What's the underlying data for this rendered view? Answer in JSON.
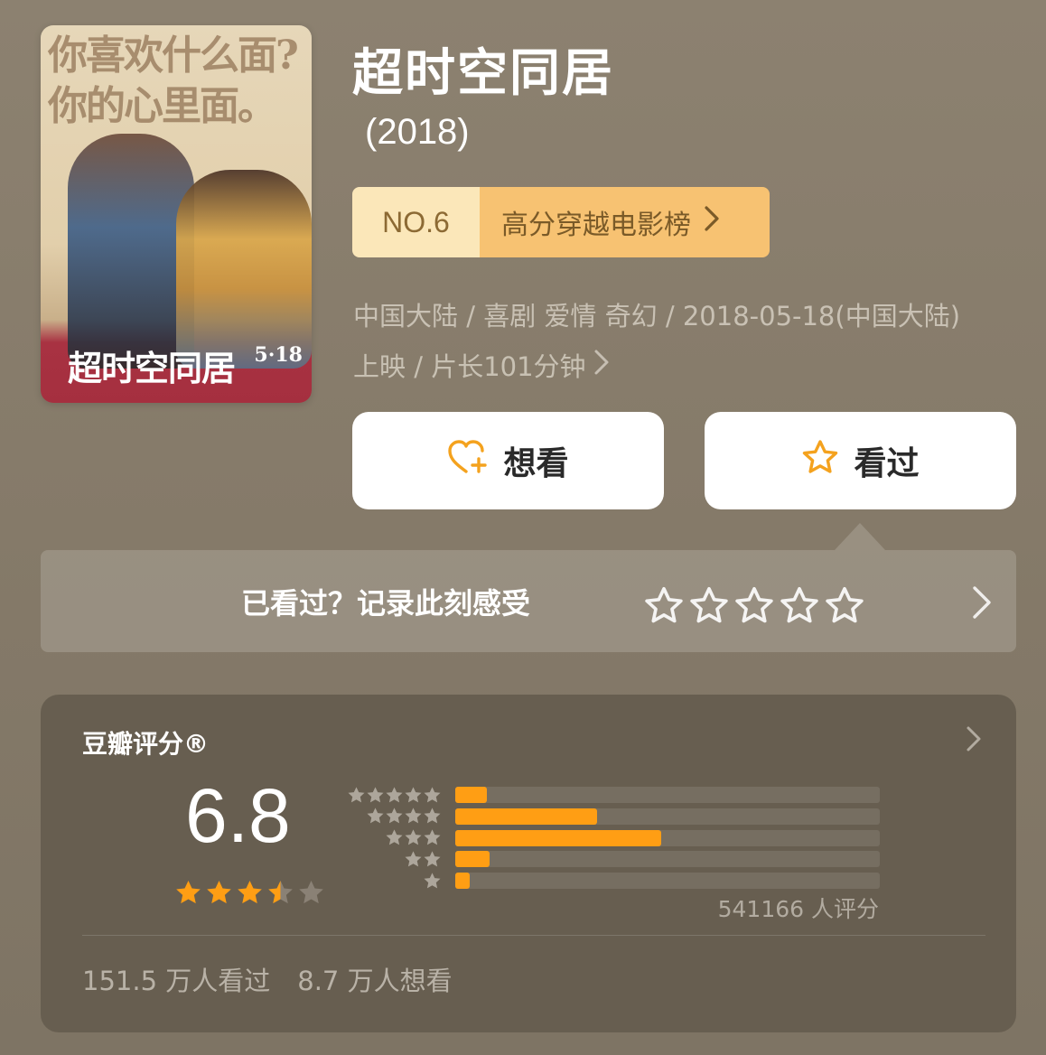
{
  "poster": {
    "tagline": "你喜欢什么面?\n你的心里面。",
    "title": "超时空同居",
    "date": "5·18"
  },
  "movie": {
    "title": "超时空同居",
    "year": "(2018)"
  },
  "rank": {
    "no": "NO.6",
    "list_name": "高分穿越电影榜"
  },
  "meta": {
    "line1": "中国大陆 / 喜剧 爱情 奇幻 / 2018-05-18(中国大陆)",
    "line2": "上映 / 片长101分钟"
  },
  "buttons": {
    "want": "想看",
    "seen": "看过"
  },
  "record": {
    "prompt": "已看过？记录此刻感受",
    "stars": 5
  },
  "rating": {
    "label": "豆瓣评分®",
    "score": "6.8",
    "stars_filled": 3.5,
    "distribution": [
      {
        "stars": 5,
        "fraction": 0.075
      },
      {
        "stars": 4,
        "fraction": 0.335
      },
      {
        "stars": 3,
        "fraction": 0.485
      },
      {
        "stars": 2,
        "fraction": 0.08
      },
      {
        "stars": 1,
        "fraction": 0.035
      }
    ],
    "count": "541166 人评分",
    "watched": "151.5 万人看过",
    "want": "8.7 万人想看"
  },
  "colors": {
    "background": "#857a69",
    "accent_orange": "#ff9e14",
    "badge_light": "#fbe7b9",
    "badge_orange": "#f7c272",
    "card": "#675e50"
  },
  "icons": {
    "want": "heart-plus-icon",
    "seen": "star-outline-icon",
    "chevron": "chevron-right-icon"
  }
}
